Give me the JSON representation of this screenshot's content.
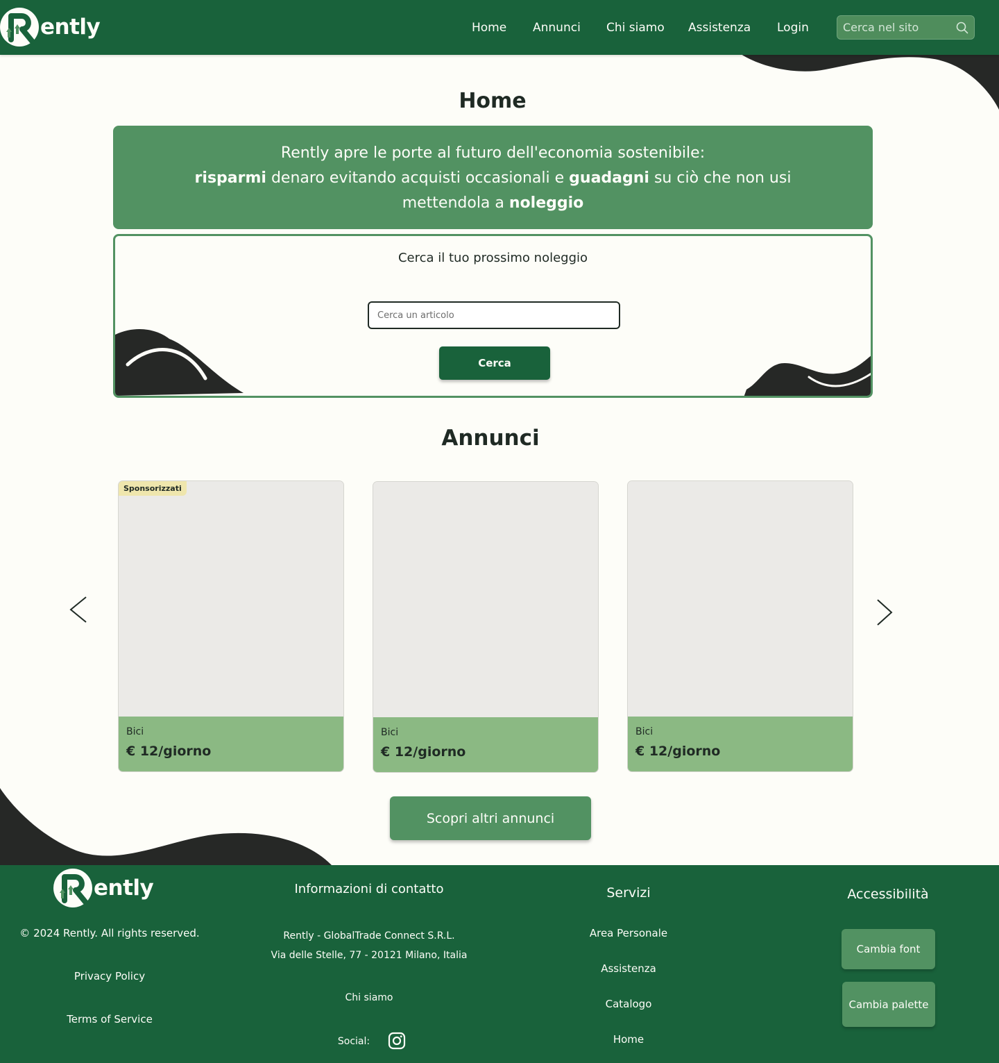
{
  "header": {
    "logo_text": "ently",
    "nav": {
      "home": "Home",
      "annunci": "Annunci",
      "chi_siamo": "Chi siamo",
      "assistenza": "Assistenza",
      "login": "Login"
    },
    "search_placeholder": "Cerca nel sito"
  },
  "page_title": "Home",
  "hero": {
    "line1": "Rently apre le porte al futuro dell'economia sostenibile:",
    "bold1": "risparmi",
    "text2": " denaro evitando acquisti occasionali e ",
    "bold2": "guadagni",
    "text3": " su ciò che non usi",
    "text4": "mettendola a ",
    "bold3": "noleggio"
  },
  "search": {
    "title": "Cerca il tuo prossimo noleggio",
    "placeholder": "Cerca un articolo",
    "button": "Cerca"
  },
  "listings": {
    "title": "Annunci",
    "badge": "Sponsorizzati",
    "cards": [
      {
        "category": "Bici",
        "price": "€ 12/giorno"
      },
      {
        "category": "Bici",
        "price": "€ 12/giorno"
      },
      {
        "category": "Bici",
        "price": "€ 12/giorno"
      }
    ],
    "more_button": "Scopri altri annunci"
  },
  "footer": {
    "logo_text": "ently",
    "copyright": "© 2024 Rently. All rights reserved.",
    "privacy": "Privacy Policy",
    "terms": "Terms of Service",
    "contact": {
      "title": "Informazioni di contatto",
      "company": "Rently - GlobalTrade Connect S.R.L.",
      "address": "Via delle Stelle, 77 - 20121 Milano, Italia",
      "about": "Chi siamo",
      "social_label": "Social:"
    },
    "services": {
      "title": "Servizi",
      "items": [
        "Area Personale",
        "Assistenza",
        "Catalogo",
        "Home"
      ]
    },
    "accessibility": {
      "title": "Accessibilità",
      "font_button": "Cambia font",
      "palette_button": "Cambia palette"
    }
  },
  "colors": {
    "primary": "#19623b",
    "secondary": "#529262",
    "card_info": "#8bb983",
    "background": "#fdfdf8",
    "decor": "#262826",
    "badge": "#efe6ad"
  },
  "icons": {
    "logo": "rently-r-logo",
    "site_search": "search-icon",
    "prev": "chevron-left-icon",
    "next": "chevron-right-icon",
    "social": "instagram-icon"
  }
}
